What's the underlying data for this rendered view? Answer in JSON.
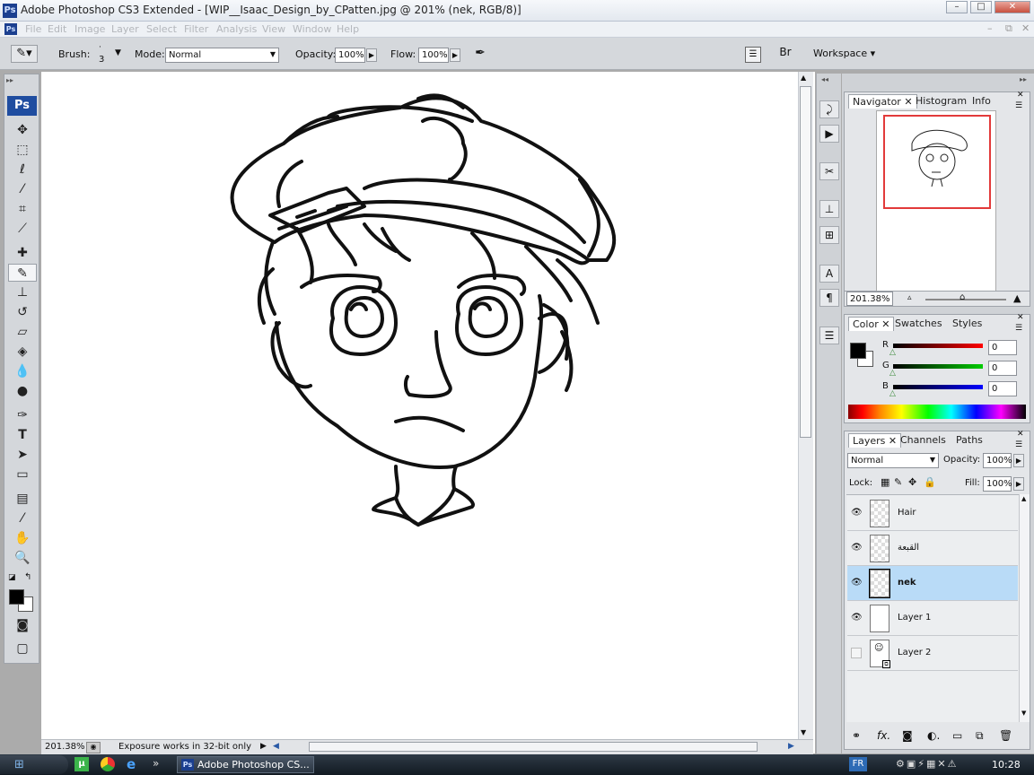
{
  "window": {
    "app_icon": "Ps",
    "title": "Adobe Photoshop CS3 Extended - [WIP__Isaac_Design_by_CPatten.jpg @ 201% (nek, RGB/8)]",
    "min_icon": "minimize-icon",
    "max_icon": "maximize-icon",
    "close_icon": "close-icon"
  },
  "menu": [
    "File",
    "Edit",
    "Image",
    "Layer",
    "Select",
    "Filter",
    "Analysis",
    "View",
    "Window",
    "Help"
  ],
  "options": {
    "brush_label": "Brush:",
    "brush_size": "3",
    "mode_label": "Mode:",
    "mode_value": "Normal",
    "opacity_label": "Opacity:",
    "opacity_value": "100%",
    "flow_label": "Flow:",
    "flow_value": "100%",
    "workspace_label": "Workspace ▾"
  },
  "toolbox": {
    "ps_label": "Ps",
    "tools": [
      "move-tool",
      "marquee-tool",
      "lasso-tool",
      "magic-wand-tool",
      "crop-tool",
      "slice-tool",
      "healing-brush-tool",
      "brush-tool",
      "clone-stamp-tool",
      "history-brush-tool",
      "eraser-tool",
      "paint-bucket-tool",
      "blur-tool",
      "dodge-tool",
      "pen-tool",
      "type-tool",
      "path-selection-tool",
      "shape-tool",
      "notes-tool",
      "eyedropper-tool",
      "hand-tool",
      "zoom-tool"
    ],
    "fg_color": "#000000",
    "bg_color": "#ffffff"
  },
  "status": {
    "zoom": "201.38%",
    "message": "Exposure works in 32-bit only"
  },
  "navigator": {
    "tabs": [
      "Navigator",
      "Histogram",
      "Info"
    ],
    "zoom": "201.38%"
  },
  "color": {
    "tabs": [
      "Color",
      "Swatches",
      "Styles"
    ],
    "r_label": "R",
    "r_value": "0",
    "g_label": "G",
    "g_value": "0",
    "b_label": "B",
    "b_value": "0",
    "fg": "#000000",
    "bg": "#ffffff"
  },
  "layers": {
    "tabs": [
      "Layers",
      "Channels",
      "Paths"
    ],
    "blend_mode": "Normal",
    "opacity_label": "Opacity:",
    "opacity_value": "100%",
    "lock_label": "Lock:",
    "fill_label": "Fill:",
    "fill_value": "100%",
    "items": [
      {
        "name": "Hair",
        "visible": true,
        "selected": false
      },
      {
        "name": "القبعة",
        "visible": true,
        "selected": false
      },
      {
        "name": "nek",
        "visible": true,
        "selected": true
      },
      {
        "name": "Layer 1",
        "visible": true,
        "selected": false
      },
      {
        "name": "Layer 2",
        "visible": false,
        "selected": false
      }
    ]
  },
  "taskbar": {
    "quicklaunch_chevron": "»",
    "task_label": "Adobe Photoshop CS...",
    "language": "FR",
    "clock": "10:28"
  }
}
